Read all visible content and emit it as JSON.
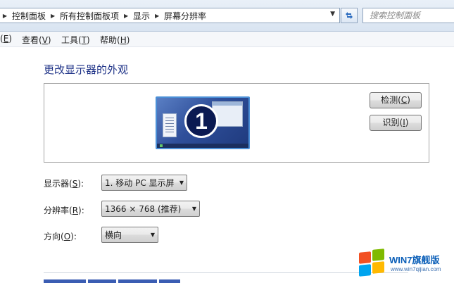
{
  "breadcrumb": {
    "items": [
      "控制面板",
      "所有控制面板项",
      "显示",
      "屏幕分辨率"
    ]
  },
  "search": {
    "placeholder": "搜索控制面板"
  },
  "menu": {
    "items": [
      {
        "prefix": "(",
        "key": "E",
        "suffix": ")"
      },
      {
        "prefix": "查看(",
        "key": "V",
        "suffix": ")"
      },
      {
        "prefix": "工具(",
        "key": "T",
        "suffix": ")"
      },
      {
        "prefix": "帮助(",
        "key": "H",
        "suffix": ")"
      }
    ]
  },
  "main": {
    "title": "更改显示器的外观",
    "monitor_number": "1",
    "detect_button": {
      "prefix": "检测(",
      "key": "C",
      "suffix": ")"
    },
    "identify_button": {
      "prefix": "识别(",
      "key": "I",
      "suffix": ")"
    },
    "display": {
      "prefix": "显示器(",
      "key": "S",
      "suffix": "):",
      "value": "1. 移动 PC 显示屏"
    },
    "resolution": {
      "prefix": "分辨率(",
      "key": "R",
      "suffix": "):",
      "value": "1366 × 768 (推荐)"
    },
    "orientation": {
      "prefix": "方向(",
      "key": "O",
      "suffix": "):",
      "value": "横向"
    }
  },
  "watermark": {
    "brand": "WIN7旗舰版",
    "url": "www.win7qijian.com"
  },
  "colors": {
    "title": "#1e3287",
    "monitor_border": "#4b8fd6",
    "watermark": "#0b5fb8"
  },
  "icons": {
    "breadcrumb_separator": "chevron-right-icon",
    "address_dropdown": "chevron-down-icon",
    "refresh": "refresh-icon",
    "combo_arrow": "chevron-down-icon",
    "logo": "windows-logo-icon"
  }
}
